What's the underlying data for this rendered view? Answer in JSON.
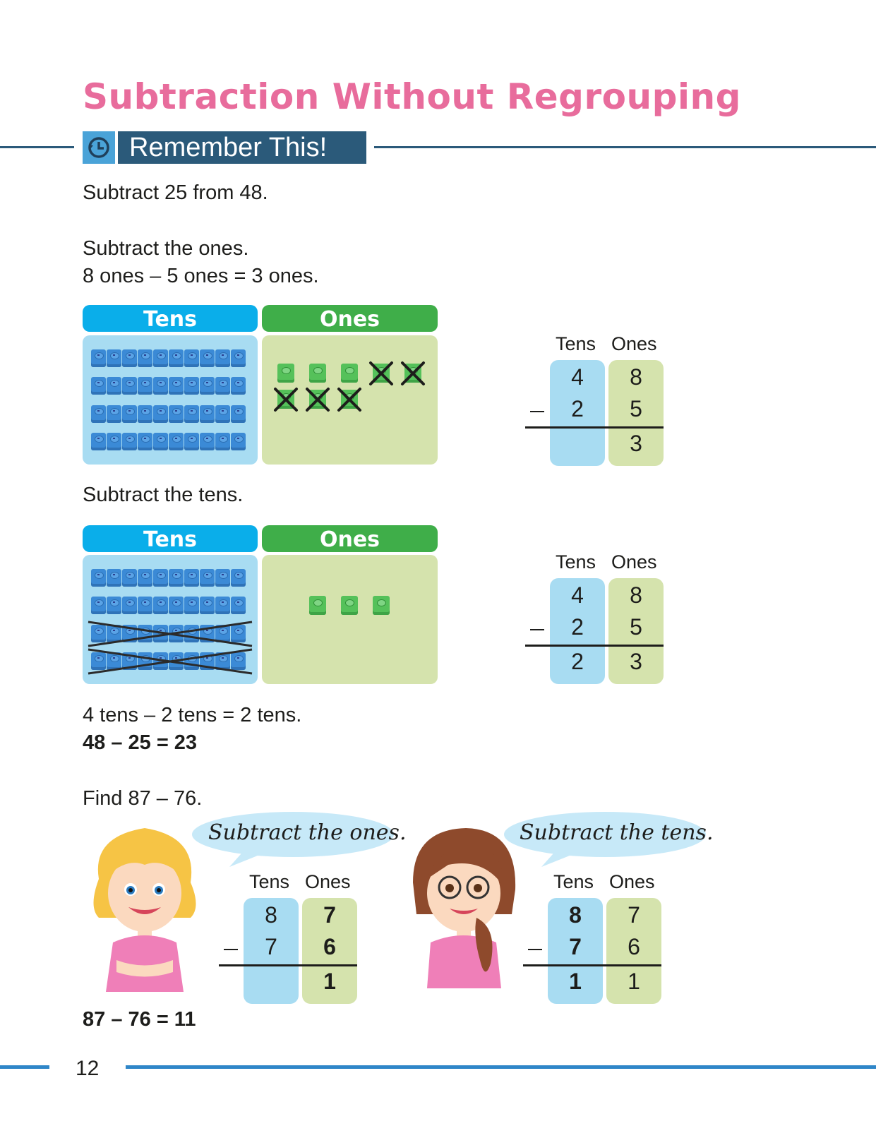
{
  "page": {
    "title": "Subtraction Without Regrouping",
    "section_label": "Remember This!",
    "section_icon": "history-clock-icon",
    "page_number": "12"
  },
  "example1": {
    "intro": "Subtract 25 from 48.",
    "step1_heading": "Subtract the ones.",
    "step1_equation": "8 ones – 5 ones = 3 ones.",
    "step2_heading": "Subtract the tens.",
    "step2_equation": "4 tens – 2 tens = 2 tens.",
    "result": "48 – 25 = 23",
    "chart_headers": {
      "tens": "Tens",
      "ones": "Ones"
    },
    "chart1": {
      "tens_rods": 4,
      "ones_units": 8,
      "ones_crossed": 5,
      "tens_crossed": 0
    },
    "chart2": {
      "tens_rods": 4,
      "tens_crossed": 2,
      "ones_units": 3
    },
    "table1": {
      "headers": [
        "Tens",
        "Ones"
      ],
      "minuend": [
        "4",
        "8"
      ],
      "subtrahend": [
        "2",
        "5"
      ],
      "difference": [
        "",
        "3"
      ],
      "operator": "–"
    },
    "table2": {
      "headers": [
        "Tens",
        "Ones"
      ],
      "minuend": [
        "4",
        "8"
      ],
      "subtrahend": [
        "2",
        "5"
      ],
      "difference": [
        "2",
        "3"
      ],
      "operator": "–"
    }
  },
  "example2": {
    "intro": "Find 87 – 76.",
    "bubble1": "Subtract the ones.",
    "bubble2": "Subtract the tens.",
    "result": "87 – 76 = 11",
    "table1": {
      "headers": [
        "Tens",
        "Ones"
      ],
      "minuend": [
        "8",
        "7"
      ],
      "subtrahend": [
        "7",
        "6"
      ],
      "difference": [
        "",
        "1"
      ],
      "operator": "–",
      "bold_column": "ones"
    },
    "table2": {
      "headers": [
        "Tens",
        "Ones"
      ],
      "minuend": [
        "8",
        "7"
      ],
      "subtrahend": [
        "7",
        "6"
      ],
      "difference": [
        "1",
        "1"
      ],
      "operator": "–",
      "bold_column": "tens"
    }
  },
  "colors": {
    "title": "#e86c9c",
    "section_bar": "#2b5a7a",
    "tens_header": "#0aaeea",
    "ones_header": "#3fae49",
    "tens_bg": "#a8dcf2",
    "ones_bg": "#d5e3ad",
    "footer_line": "#2f86c8"
  }
}
